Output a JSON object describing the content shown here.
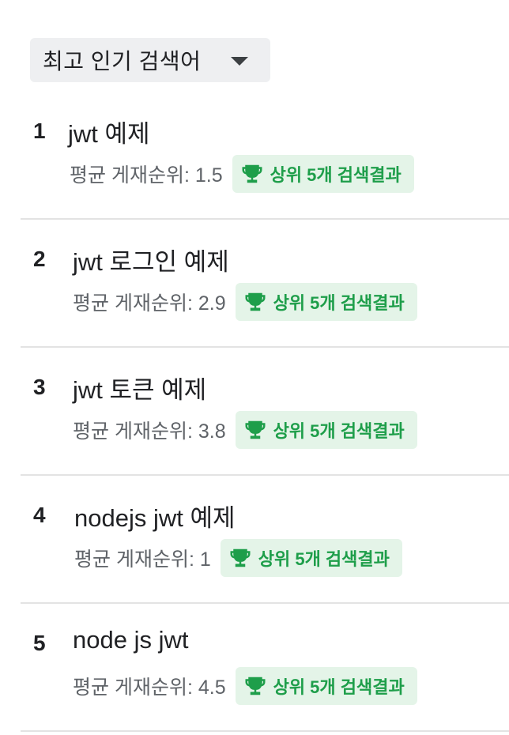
{
  "dropdown": {
    "label": "최고 인기 검색어"
  },
  "items": [
    {
      "rank": "1",
      "query": "jwt 예제",
      "avg": "평균 게재순위: 1.5",
      "badge": "상위 5개 검색결과"
    },
    {
      "rank": "2",
      "query": "jwt 로그인 예제",
      "avg": "평균 게재순위: 2.9",
      "badge": "상위 5개 검색결과"
    },
    {
      "rank": "3",
      "query": "jwt 토큰 예제",
      "avg": "평균 게재순위: 3.8",
      "badge": "상위 5개 검색결과"
    },
    {
      "rank": "4",
      "query": "nodejs jwt 예제",
      "avg": "평균 게재순위: 1",
      "badge": "상위 5개 검색결과"
    },
    {
      "rank": "5",
      "query": "node js jwt",
      "avg": "평균 게재순위: 4.5",
      "badge": "상위 5개 검색결과"
    }
  ],
  "colors": {
    "badge_bg": "#e4f4e8",
    "badge_text": "#1e9e4a",
    "dropdown_bg": "#eeeff1"
  }
}
